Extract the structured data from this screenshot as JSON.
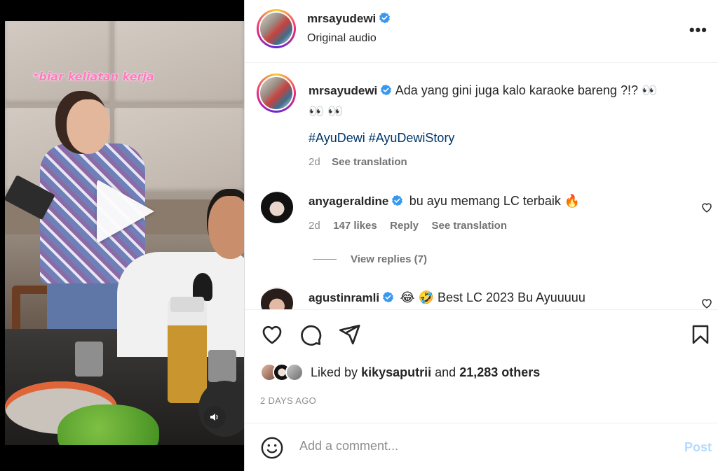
{
  "video": {
    "overlay_caption": "*biar keliatan kerja"
  },
  "header": {
    "username": "mrsayudewi",
    "audio": "Original audio",
    "more_label": "•••"
  },
  "caption": {
    "username": "mrsayudewi",
    "text": "Ada yang gini juga kalo karaoke bareng ?!? 👀",
    "text2": "👀 👀",
    "hashtags": "#AyuDewi #AyuDewiStory",
    "time": "2d",
    "see_translation": "See translation"
  },
  "comments": [
    {
      "username": "anyageraldine",
      "text": "bu ayu memang LC terbaik 🔥",
      "time": "2d",
      "likes": "147 likes",
      "reply": "Reply",
      "see_translation": "See translation",
      "view_replies": "View replies (7)"
    },
    {
      "username": "agustinramli",
      "text": "😂 🤣 Best LC 2023 Bu Ayuuuuu"
    }
  ],
  "likes": {
    "prefix": "Liked by",
    "user": "kikysaputrii",
    "and": "and",
    "others": "21,283 others"
  },
  "date": "2 DAYS AGO",
  "add_comment": {
    "placeholder": "Add a comment...",
    "post_label": "Post"
  },
  "colors": {
    "verified": "#3897f0",
    "link": "#00376b",
    "post_disabled": "#b3dbff"
  }
}
